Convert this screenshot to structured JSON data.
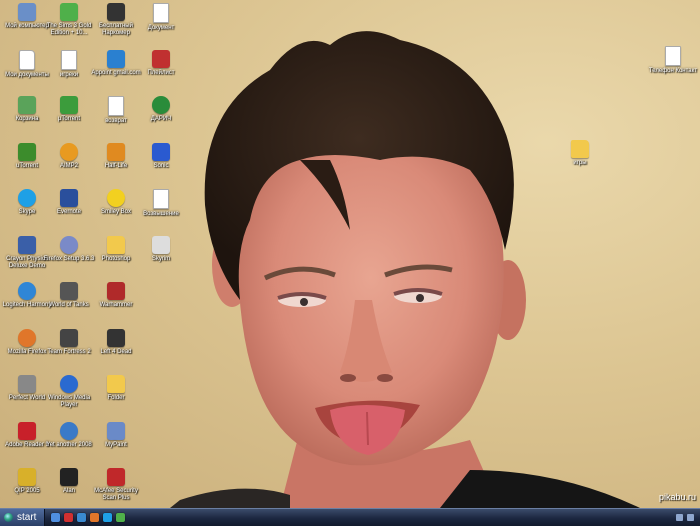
{
  "desktop": {
    "icons": [
      {
        "label": "Мой компьютер",
        "icon": "computer-icon",
        "color": "#6a8fc8"
      },
      {
        "label": "Мои документы",
        "icon": "documents-folder-icon",
        "color": "#f2c94c"
      },
      {
        "label": "Корзина",
        "icon": "recycle-bin-icon",
        "color": "#5aa35a"
      },
      {
        "label": "uTorrent",
        "icon": "utorrent-icon",
        "color": "#3c8c2c"
      },
      {
        "label": "Skype",
        "icon": "skype-icon",
        "color": "#1ea0e6"
      },
      {
        "label": "Crayon Physics Deluxe Demo",
        "icon": "crayon-physics-icon",
        "color": "#3a5fa8"
      },
      {
        "label": "Logitech Harmony",
        "icon": "logitech-harmony-icon",
        "color": "#2f86d6"
      },
      {
        "label": "Mozilla Firefox",
        "icon": "firefox-icon",
        "color": "#e0762a"
      },
      {
        "label": "Perfect World",
        "icon": "perfect-world-icon",
        "color": "#888888"
      },
      {
        "label": "Adobe Reader 9",
        "icon": "adobe-reader-icon",
        "color": "#c8202a"
      },
      {
        "label": "QIP 2005",
        "icon": "qip-icon",
        "color": "#d8b02a"
      },
      {
        "label": "The Sims 3 Gold Edition + 10...",
        "icon": "sims3-icon",
        "color": "#4fb04a"
      },
      {
        "label": "игреки",
        "icon": "document-icon",
        "color": "#ffffff"
      },
      {
        "label": "µTorrent",
        "icon": "utorrent-icon",
        "color": "#3c9c3c"
      },
      {
        "label": "AIMP2",
        "icon": "aimp-icon",
        "color": "#e89a20"
      },
      {
        "label": "Evernote",
        "icon": "evernote-icon",
        "color": "#2a4f9c"
      },
      {
        "label": "Firefox Setup 3.6.3",
        "icon": "firefox-setup-icon",
        "color": "#7a8ac8"
      },
      {
        "label": "World of Tanks",
        "icon": "wot-launcher-icon",
        "color": "#555555"
      },
      {
        "label": "Team Fortress 2",
        "icon": "tf2-icon",
        "color": "#444444"
      },
      {
        "label": "Windows Media Player",
        "icon": "media-player-icon",
        "color": "#2a6ad0"
      },
      {
        "label": "Yet another 2008",
        "icon": "globe-icon",
        "color": "#3a7ac8"
      },
      {
        "label": "Alan",
        "icon": "alan-wake-icon",
        "color": "#222222"
      },
      {
        "label": "Бесплатный Наркомер",
        "icon": "wp-app-icon",
        "color": "#333333"
      },
      {
        "label": "Appoint gmail.com",
        "icon": "gmail-icon",
        "color": "#2a80d0"
      },
      {
        "label": "возврат",
        "icon": "document-icon",
        "color": "#ffffff"
      },
      {
        "label": "Half-Life",
        "icon": "half-life-icon",
        "color": "#e08a20"
      },
      {
        "label": "Smiley Box",
        "icon": "smiley-icon",
        "color": "#f2d020"
      },
      {
        "label": "Photoshop",
        "icon": "folder-icon",
        "color": "#f2c94c"
      },
      {
        "label": "Warhammer",
        "icon": "game-icon",
        "color": "#b02a2a"
      },
      {
        "label": "Left 4 Dead",
        "icon": "left4dead-icon",
        "color": "#333333"
      },
      {
        "label": "Folder",
        "icon": "folder-icon",
        "color": "#f2c94c"
      },
      {
        "label": "MyPaint",
        "icon": "mypaint-icon",
        "color": "#6a8ac8"
      },
      {
        "label": "McAfee Security Scan Plus",
        "icon": "mcafee-icon",
        "color": "#c0282a"
      },
      {
        "label": "Документ",
        "icon": "document-icon",
        "color": "#ffffff"
      },
      {
        "label": "Плейлист",
        "icon": "playlist-icon",
        "color": "#c03030"
      },
      {
        "label": "ДАРИЧ",
        "icon": "dari-icon",
        "color": "#2a8c3a"
      },
      {
        "label": "Sonic",
        "icon": "sonic-icon",
        "color": "#2a5ad0"
      },
      {
        "label": "Возвышение",
        "icon": "document-icon",
        "color": "#ffffff"
      },
      {
        "label": "Skyrim",
        "icon": "skyrim-icon",
        "color": "#dddddd"
      },
      {
        "label": "Телефон Контакт",
        "icon": "document-icon",
        "color": "#ffffff"
      },
      {
        "label": "игры",
        "icon": "folder-icon",
        "color": "#f2c94c"
      }
    ]
  },
  "taskbar": {
    "start_label": "start",
    "quick_launch": [
      {
        "icon": "browser-icon",
        "color": "#4f8fe0"
      },
      {
        "icon": "opera-icon",
        "color": "#d03030"
      },
      {
        "icon": "ie-icon",
        "color": "#3a8ad0"
      },
      {
        "icon": "firefox-icon",
        "color": "#e0762a"
      },
      {
        "icon": "skype-icon",
        "color": "#1ea0e6"
      },
      {
        "icon": "chrome-icon",
        "color": "#4fb04a"
      }
    ]
  },
  "watermark": "pikabu.ru"
}
